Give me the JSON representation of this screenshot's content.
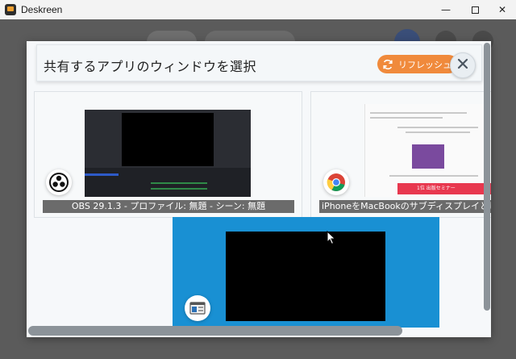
{
  "window": {
    "title": "Deskreen",
    "minimize_glyph": "—",
    "close_glyph": "✕"
  },
  "dialog": {
    "title": "共有するアプリのウィンドウを選択",
    "refresh_label": "リフレッシュ",
    "refresh_color": "#f08a3c",
    "selected_color": "#1990d3"
  },
  "windows": [
    {
      "label": "OBS 29.1.3 - プロファイル: 無題 - シーン: 無題",
      "icon": "obs-icon"
    },
    {
      "label": "iPhoneをMacBookのサブディスプレイとして使う方法",
      "icon": "chrome-icon"
    },
    {
      "label": "",
      "icon": "app-window-icon",
      "selected": true
    }
  ],
  "thumbnails": {
    "web_ad_text": "1位 出版セミナー"
  }
}
